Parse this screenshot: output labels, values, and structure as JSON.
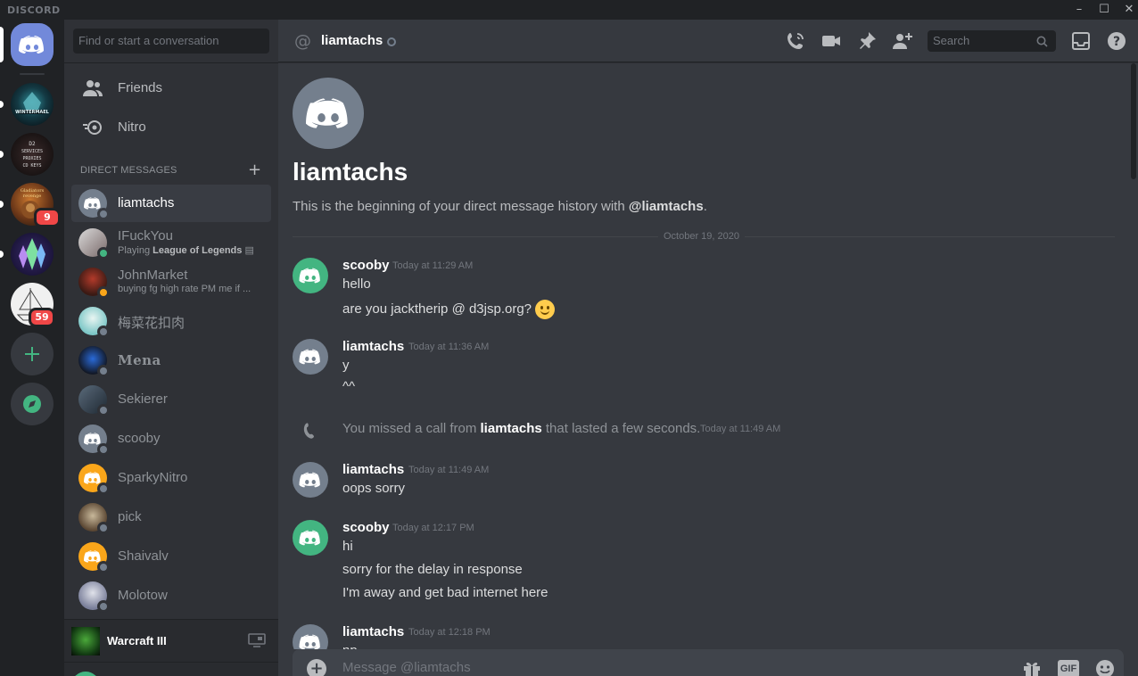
{
  "app": {
    "brand": "DISCORD"
  },
  "servers": [
    {
      "name": "Home",
      "icon": "discord-logo-icon"
    },
    {
      "name": "Wintermael",
      "icon": "server-wintermael"
    },
    {
      "name": "D2 Services Proxies CD Keys",
      "icon": "server-d2"
    },
    {
      "name": "Gladiators revenge",
      "icon": "server-gladiators",
      "badge": "9"
    },
    {
      "name": "Crystals",
      "icon": "server-crystals"
    },
    {
      "name": "Ship",
      "icon": "server-ship",
      "badge": "59"
    }
  ],
  "sidebar": {
    "search_placeholder": "Find or start a conversation",
    "friends_label": "Friends",
    "nitro_label": "Nitro",
    "dm_header": "DIRECT MESSAGES",
    "dms": [
      {
        "name": "liamtachs",
        "status": "offline",
        "active": true
      },
      {
        "name": "IFuckYou",
        "sub_prefix": "Playing ",
        "sub_bold": "League of Legends",
        "status": "online"
      },
      {
        "name": "JohnMarket",
        "sub": "buying fg high rate PM me if ...",
        "status": "idle"
      },
      {
        "name": "梅菜花扣肉",
        "status": "offline"
      },
      {
        "name": "Mena",
        "status": "offline"
      },
      {
        "name": "Sekierer",
        "status": "offline"
      },
      {
        "name": "scooby",
        "status": "offline"
      },
      {
        "name": "SparkyNitro",
        "status": "offline"
      },
      {
        "name": "pick",
        "status": "offline"
      },
      {
        "name": "Shaivalv",
        "status": "offline"
      },
      {
        "name": "Molotow",
        "status": "offline"
      }
    ],
    "activity": {
      "game": "Warcraft III"
    }
  },
  "header": {
    "channel": "liamtachs",
    "search_placeholder": "Search"
  },
  "chat": {
    "intro_name": "liamtachs",
    "intro_prefix": "This is the beginning of your direct message history with ",
    "intro_handle": "@liamtachs",
    "intro_suffix": ".",
    "date_divider": "October 19, 2020",
    "messages": [
      {
        "author": "scooby",
        "time": "Today at 11:29 AM",
        "lines": [
          "hello",
          "are you jacktherip @ d3jsp.org?"
        ],
        "avatar_color": "#43b581"
      },
      {
        "author": "liamtachs",
        "time": "Today at 11:36 AM",
        "lines": [
          "y",
          "^^"
        ],
        "avatar_color": "#747f8d"
      },
      {
        "system_prefix": "You missed a call from ",
        "system_name": "liamtachs",
        "system_suffix": " that lasted a few seconds.",
        "time": "Today at 11:49 AM"
      },
      {
        "author": "liamtachs",
        "time": "Today at 11:49 AM",
        "lines": [
          "oops sorry"
        ],
        "avatar_color": "#747f8d"
      },
      {
        "author": "scooby",
        "time": "Today at 12:17 PM",
        "lines": [
          "hi",
          "sorry for the delay in response",
          "I'm away and get bad internet here"
        ],
        "avatar_color": "#43b581"
      },
      {
        "author": "liamtachs",
        "time": "Today at 12:18 PM",
        "lines": [
          "np"
        ],
        "avatar_color": "#747f8d"
      }
    ],
    "composer_placeholder": "Message @liamtachs",
    "gif_label": "GIF"
  }
}
